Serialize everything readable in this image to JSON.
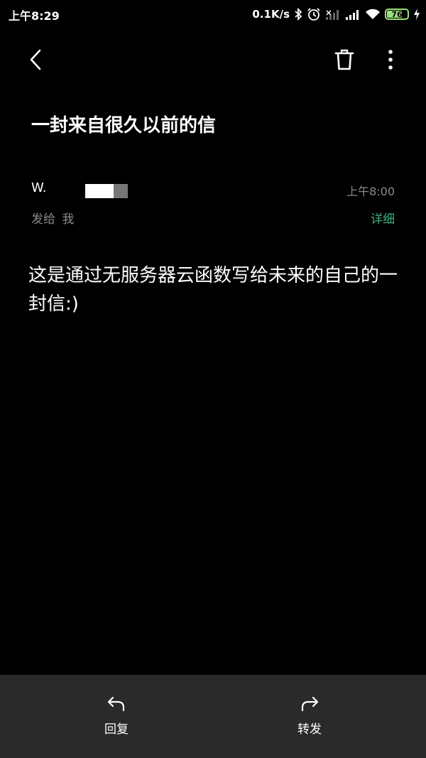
{
  "status_bar": {
    "time": "上午8:29",
    "net_speed": "0.1K/s",
    "battery_level": "76",
    "battery_color": "#9be07a"
  },
  "toolbar": {
    "back_icon": "chevron-left-icon",
    "delete_icon": "trash-icon",
    "more_icon": "more-vertical-icon"
  },
  "mail": {
    "subject": "一封来自很久以前的信",
    "sender": "W.",
    "sent_time": "上午8:00",
    "recipient_text": "发给 我",
    "details_label": "详细",
    "body": "这是通过无服务器云函数写给未来的自己的一封信:)"
  },
  "bottom_bar": {
    "reply_label": "回复",
    "forward_label": "转发"
  },
  "colors": {
    "background": "#000000",
    "accent_green": "#3fae7f",
    "secondary_text": "#8a8a8a",
    "bottom_bar_bg": "#2a2a2a"
  }
}
